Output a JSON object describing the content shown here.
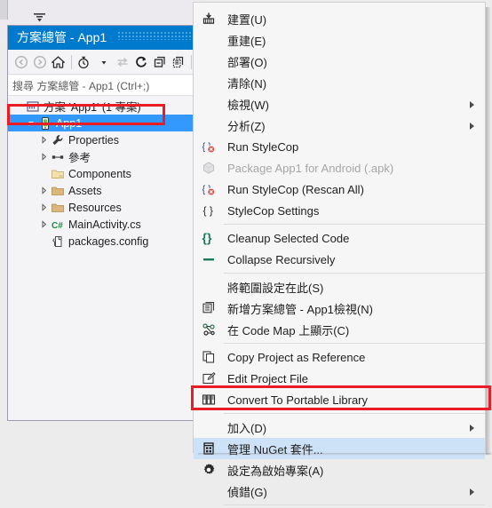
{
  "window": {
    "background_color": "#ececed"
  },
  "solution_explorer": {
    "title": "方案總管 - App1",
    "search_placeholder": "搜尋 方案總管 - App1 (Ctrl+;)",
    "toolbar": [
      {
        "name": "back-button",
        "icon": "back-arrow-icon",
        "enabled": false
      },
      {
        "name": "forward-button",
        "icon": "forward-arrow-icon",
        "enabled": false
      },
      {
        "name": "home-button",
        "icon": "home-icon",
        "enabled": true
      },
      {
        "name": "pending-changes-button",
        "icon": "clock-filter-icon",
        "enabled": true
      },
      {
        "name": "sync-with-active-document-button",
        "icon": "sync-arrows-icon",
        "enabled": false
      },
      {
        "name": "refresh-button",
        "icon": "refresh-icon",
        "enabled": true
      },
      {
        "name": "collapse-all-button",
        "icon": "collapse-all-icon",
        "enabled": true
      },
      {
        "name": "show-all-files-button",
        "icon": "show-all-files-icon",
        "enabled": true
      }
    ],
    "tree": [
      {
        "label": "方案 'App1' (1 專案)",
        "icon": "solution-icon",
        "indent": 0,
        "twisty": "none",
        "selected": false
      },
      {
        "label": "App1",
        "icon": "android-project-icon",
        "indent": 1,
        "twisty": "expanded",
        "selected": true
      },
      {
        "label": "Properties",
        "icon": "wrench-icon",
        "indent": 2,
        "twisty": "collapsed",
        "selected": false
      },
      {
        "label": "參考",
        "icon": "references-icon",
        "indent": 2,
        "twisty": "collapsed",
        "selected": false
      },
      {
        "label": "Components",
        "icon": "components-folder-icon",
        "indent": 2,
        "twisty": "none",
        "selected": false
      },
      {
        "label": "Assets",
        "icon": "folder-icon",
        "indent": 2,
        "twisty": "collapsed",
        "selected": false
      },
      {
        "label": "Resources",
        "icon": "folder-icon",
        "indent": 2,
        "twisty": "collapsed",
        "selected": false
      },
      {
        "label": "MainActivity.cs",
        "icon": "csharp-file-icon",
        "indent": 2,
        "twisty": "collapsed",
        "selected": false
      },
      {
        "label": "packages.config",
        "icon": "config-file-icon",
        "indent": 2,
        "twisty": "none",
        "selected": false
      }
    ]
  },
  "context_menu": {
    "items": [
      {
        "label": "建置(U)",
        "icon": "build-icon",
        "submenu": false,
        "disabled": false,
        "highlighted": false,
        "separator_after": false
      },
      {
        "label": "重建(E)",
        "icon": "none",
        "submenu": false,
        "disabled": false,
        "highlighted": false,
        "separator_after": false
      },
      {
        "label": "部署(O)",
        "icon": "none",
        "submenu": false,
        "disabled": false,
        "highlighted": false,
        "separator_after": false
      },
      {
        "label": "清除(N)",
        "icon": "none",
        "submenu": false,
        "disabled": false,
        "highlighted": false,
        "separator_after": false
      },
      {
        "label": "檢視(W)",
        "icon": "none",
        "submenu": true,
        "disabled": false,
        "highlighted": false,
        "separator_after": false
      },
      {
        "label": "分析(Z)",
        "icon": "none",
        "submenu": true,
        "disabled": false,
        "highlighted": false,
        "separator_after": false
      },
      {
        "label": "Run StyleCop",
        "icon": "stylecop-run-icon",
        "submenu": false,
        "disabled": false,
        "highlighted": false,
        "separator_after": false
      },
      {
        "label": "Package App1 for Android (.apk)",
        "icon": "package-cube-icon",
        "submenu": false,
        "disabled": true,
        "highlighted": false,
        "separator_after": false
      },
      {
        "label": "Run StyleCop (Rescan All)",
        "icon": "stylecop-run-icon",
        "submenu": false,
        "disabled": false,
        "highlighted": false,
        "separator_after": false
      },
      {
        "label": "StyleCop Settings",
        "icon": "stylecop-settings-icon",
        "submenu": false,
        "disabled": false,
        "highlighted": false,
        "separator_after": true
      },
      {
        "label": "Cleanup Selected Code",
        "icon": "braces-icon",
        "submenu": false,
        "disabled": false,
        "highlighted": false,
        "separator_after": false
      },
      {
        "label": "Collapse Recursively",
        "icon": "minus-icon",
        "submenu": false,
        "disabled": false,
        "highlighted": false,
        "separator_after": true
      },
      {
        "label": "將範圍設定在此(S)",
        "icon": "none",
        "submenu": false,
        "disabled": false,
        "highlighted": false,
        "separator_after": false
      },
      {
        "label": "新增方案總管 - App1檢視(N)",
        "icon": "new-solution-view-icon",
        "submenu": false,
        "disabled": false,
        "highlighted": false,
        "separator_after": false
      },
      {
        "label": "在 Code Map 上顯示(C)",
        "icon": "code-map-icon",
        "submenu": false,
        "disabled": false,
        "highlighted": false,
        "separator_after": true
      },
      {
        "label": "Copy Project as Reference",
        "icon": "copy-reference-icon",
        "submenu": false,
        "disabled": false,
        "highlighted": false,
        "separator_after": false
      },
      {
        "label": "Edit Project File",
        "icon": "edit-project-file-icon",
        "submenu": false,
        "disabled": false,
        "highlighted": false,
        "separator_after": false
      },
      {
        "label": "Convert To Portable Library",
        "icon": "portable-library-icon",
        "submenu": false,
        "disabled": false,
        "highlighted": false,
        "separator_after": true
      },
      {
        "label": "加入(D)",
        "icon": "none",
        "submenu": true,
        "disabled": false,
        "highlighted": false,
        "separator_after": false
      },
      {
        "label": "管理 NuGet 套件...",
        "icon": "nuget-icon",
        "submenu": false,
        "disabled": false,
        "highlighted": true,
        "separator_after": false
      },
      {
        "label": "設定為啟始專案(A)",
        "icon": "gear-icon",
        "submenu": false,
        "disabled": false,
        "highlighted": false,
        "separator_after": false
      },
      {
        "label": "偵錯(G)",
        "icon": "none",
        "submenu": true,
        "disabled": false,
        "highlighted": false,
        "separator_after": true
      }
    ]
  },
  "annotations": {
    "color": "#ec1c24",
    "boxes": [
      {
        "name": "highlight-app1-project",
        "target": "App1"
      },
      {
        "name": "highlight-manage-nuget",
        "target": "管理 NuGet 套件..."
      }
    ]
  }
}
